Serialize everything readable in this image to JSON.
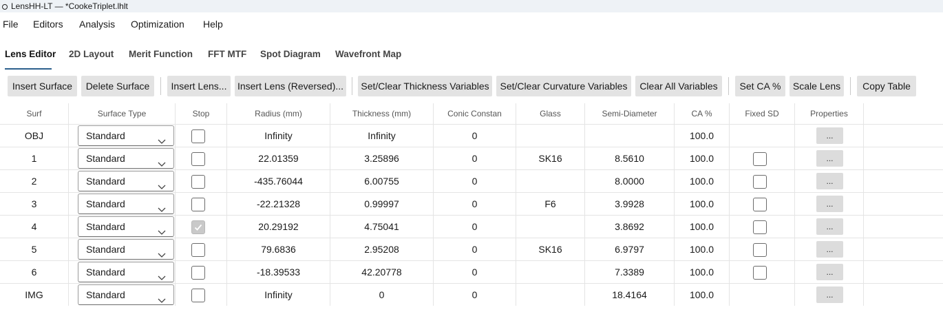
{
  "window": {
    "title": "LensHH-LT — *CookeTriplet.lhlt"
  },
  "menu": [
    "File",
    "Editors",
    "Analysis",
    "Optimization",
    "Help"
  ],
  "tabs": [
    "Lens Editor",
    "2D Layout",
    "Merit Function",
    "FFT MTF",
    "Spot Diagram",
    "Wavefront Map"
  ],
  "active_tab": "Lens Editor",
  "toolbar": {
    "insert_surface": "Insert Surface",
    "delete_surface": "Delete Surface",
    "insert_lens": "Insert Lens...",
    "insert_lens_reversed": "Insert Lens (Reversed)...",
    "set_clear_thickness": "Set/Clear Thickness Variables",
    "set_clear_curvature": "Set/Clear Curvature Variables",
    "clear_all": "Clear All Variables",
    "set_ca": "Set CA %",
    "scale_lens": "Scale Lens",
    "copy_table": "Copy Table"
  },
  "columns": [
    "Surf",
    "Surface Type",
    "Stop",
    "Radius (mm)",
    "Thickness (mm)",
    "Conic Constan",
    "Glass",
    "Semi-Diameter",
    "CA %",
    "Fixed SD",
    "Properties"
  ],
  "properties_label": "...",
  "rows": [
    {
      "surf": "OBJ",
      "type": "Standard",
      "stop": false,
      "radius": "Infinity",
      "thickness": "Infinity",
      "conic": "0",
      "glass": "",
      "semi": "",
      "ca": "100.0",
      "fixed_sd": null
    },
    {
      "surf": "1",
      "type": "Standard",
      "stop": false,
      "radius": "22.01359",
      "thickness": "3.25896",
      "conic": "0",
      "glass": "SK16",
      "semi": "8.5610",
      "ca": "100.0",
      "fixed_sd": false
    },
    {
      "surf": "2",
      "type": "Standard",
      "stop": false,
      "radius": "-435.76044",
      "thickness": "6.00755",
      "conic": "0",
      "glass": "",
      "semi": "8.0000",
      "ca": "100.0",
      "fixed_sd": false
    },
    {
      "surf": "3",
      "type": "Standard",
      "stop": false,
      "radius": "-22.21328",
      "thickness": "0.99997",
      "conic": "0",
      "glass": "F6",
      "semi": "3.9928",
      "ca": "100.0",
      "fixed_sd": false
    },
    {
      "surf": "4",
      "type": "Standard",
      "stop": true,
      "radius": "20.29192",
      "thickness": "4.75041",
      "conic": "0",
      "glass": "",
      "semi": "3.8692",
      "ca": "100.0",
      "fixed_sd": false
    },
    {
      "surf": "5",
      "type": "Standard",
      "stop": false,
      "radius": "79.6836",
      "thickness": "2.95208",
      "conic": "0",
      "glass": "SK16",
      "semi": "6.9797",
      "ca": "100.0",
      "fixed_sd": false
    },
    {
      "surf": "6",
      "type": "Standard",
      "stop": false,
      "radius": "-18.39533",
      "thickness": "42.20778",
      "conic": "0",
      "glass": "",
      "semi": "7.3389",
      "ca": "100.0",
      "fixed_sd": false
    },
    {
      "surf": "IMG",
      "type": "Standard",
      "stop": false,
      "radius": "Infinity",
      "thickness": "0",
      "conic": "0",
      "glass": "",
      "semi": "18.4164",
      "ca": "100.0",
      "fixed_sd": null
    }
  ],
  "colors": {
    "accent": "#2b5f8c",
    "button_bg": "#e3e3e3",
    "title_bg": "#eef2f6"
  }
}
